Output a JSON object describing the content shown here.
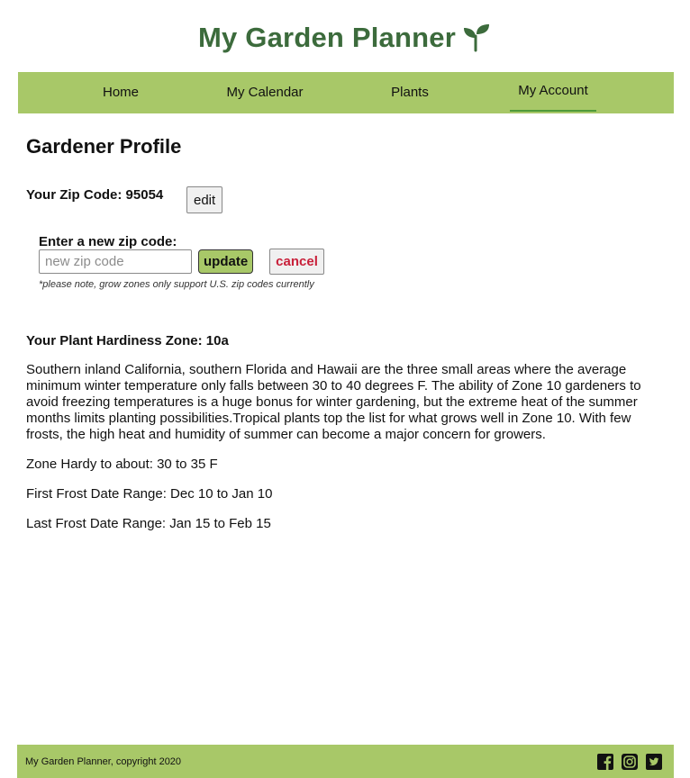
{
  "app": {
    "title": "My Garden Planner",
    "accent_color": "#a8c868",
    "title_color": "#3c6b3c",
    "logo_icon": "sprout-icon"
  },
  "nav": {
    "items": [
      {
        "label": "Home"
      },
      {
        "label": "My Calendar"
      },
      {
        "label": "Plants"
      },
      {
        "label": "My Account"
      }
    ],
    "active": "My Account"
  },
  "profile": {
    "page_title": "Gardener Profile",
    "zip_label": "Your Zip Code: 95054",
    "edit_label": "edit",
    "form": {
      "label": "Enter a new zip code:",
      "placeholder": "new zip code",
      "update_label": "update",
      "cancel_label": "cancel",
      "note": "*please note, grow zones only support U.S. zip codes currently"
    }
  },
  "zone": {
    "title": "Your Plant Hardiness Zone: 10a",
    "description": "Southern inland California, southern Florida and Hawaii are the three small areas where the average minimum winter temperature only falls between 30 to 40 degrees F. The ability of Zone 10 gardeners to avoid freezing temperatures is a huge bonus for winter gardening, but the extreme heat of the summer months limits planting possibilities.Tropical plants top the list for what grows well in Zone 10. With few frosts, the high heat and humidity of summer can become a major concern for growers.",
    "hardy": "Zone Hardy to about: 30 to 35 F",
    "first_frost": "First Frost Date Range: Dec 10 to Jan 10",
    "last_frost": "Last Frost Date Range: Jan 15 to Feb 15"
  },
  "footer": {
    "copyright": "My Garden Planner, copyright 2020",
    "social": [
      "facebook-icon",
      "instagram-icon",
      "twitter-icon"
    ]
  }
}
